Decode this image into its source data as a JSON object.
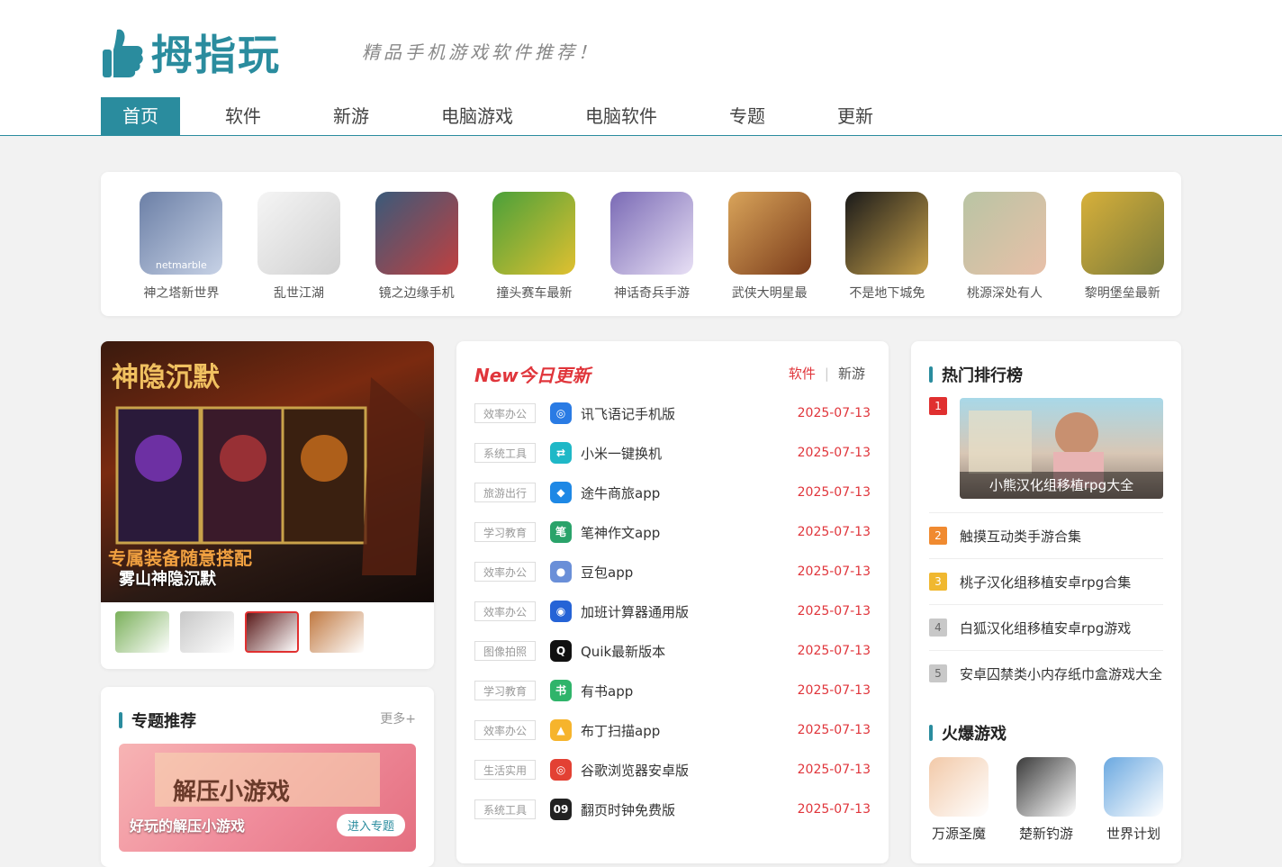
{
  "logo": {
    "text": "拇指玩",
    "slogan": "精品手机游戏软件推荐！"
  },
  "nav": [
    "首页",
    "软件",
    "新游",
    "电脑游戏",
    "电脑软件",
    "专题",
    "更新"
  ],
  "apps": [
    {
      "name": "神之塔新世界",
      "colors": [
        "#6b7fa6",
        "#c7d2e6"
      ],
      "badge": "netmarble"
    },
    {
      "name": "乱世江湖",
      "colors": [
        "#f5f5f5",
        "#d0d0d0"
      ]
    },
    {
      "name": "镜之边缘手机",
      "colors": [
        "#3a5a7a",
        "#c04040"
      ]
    },
    {
      "name": "撞头赛车最新",
      "colors": [
        "#4aa03a",
        "#e0c030"
      ]
    },
    {
      "name": "神话奇兵手游",
      "colors": [
        "#7a6ab5",
        "#e8e0f5"
      ]
    },
    {
      "name": "武侠大明星最",
      "colors": [
        "#d9a45a",
        "#7a3b1a"
      ]
    },
    {
      "name": "不是地下城免",
      "colors": [
        "#1a1a1a",
        "#c9a24a"
      ]
    },
    {
      "name": "桃源深处有人",
      "colors": [
        "#b9c4a4",
        "#e8c0a8"
      ]
    },
    {
      "name": "黎明堡垒最新",
      "colors": [
        "#d7b03a",
        "#7a7a3a"
      ]
    }
  ],
  "banner": {
    "title": "雾山神隐沉默",
    "thumbs": [
      "#7ab05a",
      "#c8c8c8",
      "#5a1a1a",
      "#c07840"
    ]
  },
  "topic": {
    "heading": "专题推荐",
    "more": "更多+",
    "caption": "好玩的解压小游戏",
    "button": "进入专题"
  },
  "updates": {
    "title": "New今日更新",
    "tabs": [
      "软件",
      "新游"
    ],
    "rows": [
      {
        "cat": "效率办公",
        "name": "讯飞语记手机版",
        "date": "2025-07-13",
        "color": "#2a7be4",
        "glyph": "◎"
      },
      {
        "cat": "系统工具",
        "name": "小米一键换机",
        "date": "2025-07-13",
        "color": "#1fb8c7",
        "glyph": "⇄"
      },
      {
        "cat": "旅游出行",
        "name": "途牛商旅app",
        "date": "2025-07-13",
        "color": "#1e88e5",
        "glyph": "◆"
      },
      {
        "cat": "学习教育",
        "name": "笔神作文app",
        "date": "2025-07-13",
        "color": "#2aa36a",
        "glyph": "笔"
      },
      {
        "cat": "效率办公",
        "name": "豆包app",
        "date": "2025-07-13",
        "color": "#6a8fd8",
        "glyph": "●"
      },
      {
        "cat": "效率办公",
        "name": "加班计算器通用版",
        "date": "2025-07-13",
        "color": "#2563d6",
        "glyph": "◉"
      },
      {
        "cat": "图像拍照",
        "name": "Quik最新版本",
        "date": "2025-07-13",
        "color": "#111111",
        "glyph": "Q"
      },
      {
        "cat": "学习教育",
        "name": "有书app",
        "date": "2025-07-13",
        "color": "#2fb46a",
        "glyph": "书"
      },
      {
        "cat": "效率办公",
        "name": "布丁扫描app",
        "date": "2025-07-13",
        "color": "#f6b42c",
        "glyph": "▲"
      },
      {
        "cat": "生活实用",
        "name": "谷歌浏览器安卓版",
        "date": "2025-07-13",
        "color": "#e34133",
        "glyph": "◎"
      },
      {
        "cat": "系统工具",
        "name": "翻页时钟免费版",
        "date": "2025-07-13",
        "color": "#222222",
        "glyph": "09"
      }
    ]
  },
  "hot": {
    "heading": "热门排行榜",
    "feature": {
      "num": "1",
      "caption": "小熊汉化组移植rpg大全",
      "color": "#e03030"
    },
    "rows": [
      {
        "num": "2",
        "name": "触摸互动类手游合集",
        "color": "#f08a30"
      },
      {
        "num": "3",
        "name": "桃子汉化组移植安卓rpg合集",
        "color": "#f0b830"
      },
      {
        "num": "4",
        "name": "白狐汉化组移植安卓rpg游戏",
        "color": "#c8c8c8"
      },
      {
        "num": "5",
        "name": "安卓囚禁类小内存纸巾盒游戏大全",
        "color": "#c8c8c8"
      }
    ],
    "hot_games_heading": "火爆游戏",
    "hot_games": [
      {
        "name": "万源圣魔",
        "color": "#f2c9a8"
      },
      {
        "name": "楚新钓游",
        "color": "#3a3a3a"
      },
      {
        "name": "世界计划",
        "color": "#6aa8e0"
      }
    ]
  }
}
